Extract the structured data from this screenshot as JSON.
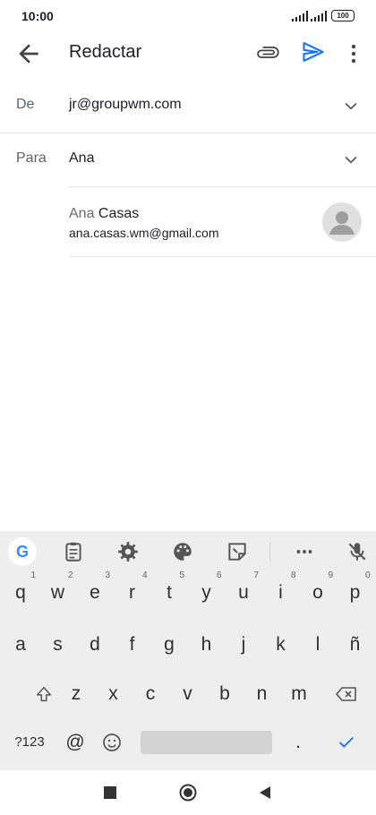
{
  "status_bar": {
    "time": "10:00",
    "battery": "100"
  },
  "app_bar": {
    "title": "Redactar",
    "icons": [
      "back-arrow-icon",
      "paperclip-icon",
      "send-icon",
      "more-vert-icon"
    ],
    "send_color": "#1a73e8"
  },
  "fields": {
    "from": {
      "label": "De",
      "value": "jr@groupwm.com"
    },
    "to": {
      "label": "Para",
      "value": "Ana"
    }
  },
  "suggestion": {
    "first_name": "Ana",
    "last_name": "Casas",
    "email": "ana.casas.wm@gmail.com"
  },
  "keyboard": {
    "toolbar_icons": [
      "google-icon",
      "clipboard-icon",
      "settings-gear-icon",
      "palette-icon",
      "sticker-icon",
      "more-horiz-icon",
      "mic-off-icon"
    ],
    "row1": [
      "q",
      "w",
      "e",
      "r",
      "t",
      "y",
      "u",
      "i",
      "o",
      "p"
    ],
    "row1_hints": [
      "1",
      "2",
      "3",
      "4",
      "5",
      "6",
      "7",
      "8",
      "9",
      "0"
    ],
    "row2": [
      "a",
      "s",
      "d",
      "f",
      "g",
      "h",
      "j",
      "k",
      "l",
      "ñ"
    ],
    "row3": [
      "z",
      "x",
      "c",
      "v",
      "b",
      "n",
      "m"
    ],
    "symbols_key": "?123",
    "at_key": "@",
    "period_key": "."
  },
  "nav_icons": [
    "recent-apps-icon",
    "home-icon",
    "back-icon"
  ]
}
